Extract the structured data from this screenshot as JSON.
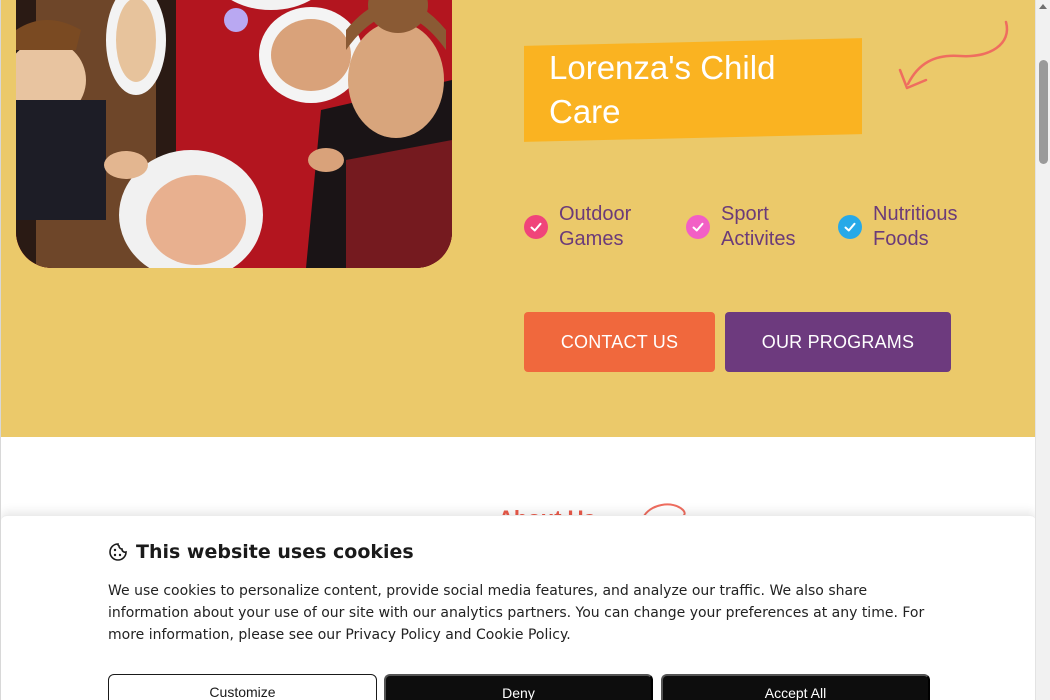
{
  "hero": {
    "brand_name": "Lorenza's Child Care",
    "features": [
      {
        "label": "Outdoor Games",
        "icon": "check-circle-icon",
        "color": "#f0447a"
      },
      {
        "label": "Sport Activites",
        "icon": "check-circle-icon",
        "color": "#f25fc5"
      },
      {
        "label": "Nutritious Foods",
        "icon": "check-circle-icon",
        "color": "#27a9e8"
      }
    ],
    "buttons": {
      "contact": "CONTACT US",
      "programs": "OUR PROGRAMS"
    }
  },
  "about": {
    "heading_peek": "About Us"
  },
  "cookie_banner": {
    "title": "This website uses cookies",
    "text": "We use cookies to personalize content, provide social media features, and analyze our traffic. We also share information about your use of our site with our analytics partners. You can change your preferences at any time. For more information, please see our Privacy Policy and Cookie Policy.",
    "buttons": {
      "customize": "Customize",
      "deny": "Deny",
      "accept": "Accept All"
    }
  },
  "colors": {
    "hero_background": "#ebc96a",
    "brand_banner": "#fab321",
    "accent_orange": "#f0683d",
    "accent_purple": "#6d3a7e",
    "cookie_button_dark": "#0d0d0d"
  }
}
